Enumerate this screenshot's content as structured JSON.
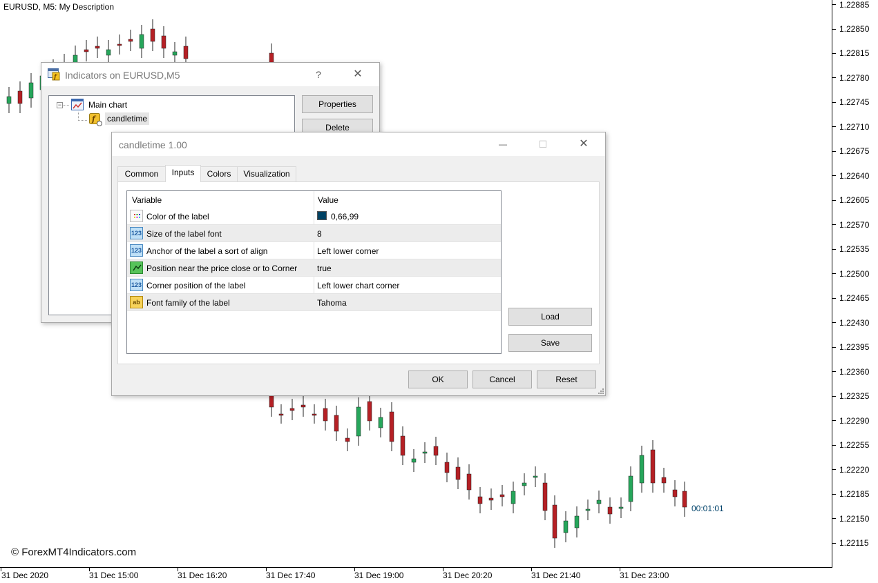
{
  "chart": {
    "title": "EURUSD, M5:  My Description",
    "watermark": "© ForexMT4Indicators.com",
    "timer": "00:01:01",
    "price_labels": [
      "1.22885",
      "1.22850",
      "1.22815",
      "1.22780",
      "1.22745",
      "1.22710",
      "1.22675",
      "1.22640",
      "1.22605",
      "1.22570",
      "1.22535",
      "1.22500",
      "1.22465",
      "1.22430",
      "1.22395",
      "1.22360",
      "1.22325",
      "1.22290",
      "1.22255",
      "1.22220",
      "1.22185",
      "1.22150",
      "1.22115"
    ],
    "time_labels": [
      "31 Dec 2020",
      "31 Dec 15:00",
      "31 Dec 16:20",
      "31 Dec 17:40",
      "31 Dec 19:00",
      "31 Dec 20:20",
      "31 Dec 21:40",
      "31 Dec 23:00"
    ],
    "colors": {
      "bull": "#26a65b",
      "bear": "#b52025",
      "timer": "#00426a"
    }
  },
  "indicators_window": {
    "title": "Indicators on EURUSD,M5",
    "help": "?",
    "close": "✕",
    "tree": {
      "root": "Main chart",
      "child": "candletime",
      "expander": "−"
    },
    "buttons": {
      "properties": "Properties",
      "delete": "Delete"
    }
  },
  "candletime_window": {
    "title": "candletime 1.00",
    "minimize": "—",
    "maximize": "☐",
    "close": "✕",
    "tabs": [
      "Common",
      "Inputs",
      "Colors",
      "Visualization"
    ],
    "active_tab": "Inputs",
    "columns": {
      "variable": "Variable",
      "value": "Value"
    },
    "rows": [
      {
        "variable": "Color of the label",
        "value": "0,66,99",
        "icon": "color-icon",
        "swatch": "#004263"
      },
      {
        "variable": "Size of the label font",
        "value": "8",
        "icon": "number-icon",
        "icon_text": "123"
      },
      {
        "variable": "Anchor of the label a sort of align",
        "value": "Left lower corner",
        "icon": "number-icon",
        "icon_text": "123"
      },
      {
        "variable": "Position near the price close or to Corner",
        "value": "true",
        "icon": "bool-icon"
      },
      {
        "variable": "Corner position of the label",
        "value": "Left lower chart corner",
        "icon": "number-icon",
        "icon_text": "123"
      },
      {
        "variable": "Font family of the label",
        "value": "Tahoma",
        "icon": "string-icon",
        "icon_text": "ab"
      }
    ],
    "buttons": {
      "load": "Load",
      "save": "Save",
      "ok": "OK",
      "cancel": "Cancel",
      "reset": "Reset"
    }
  }
}
